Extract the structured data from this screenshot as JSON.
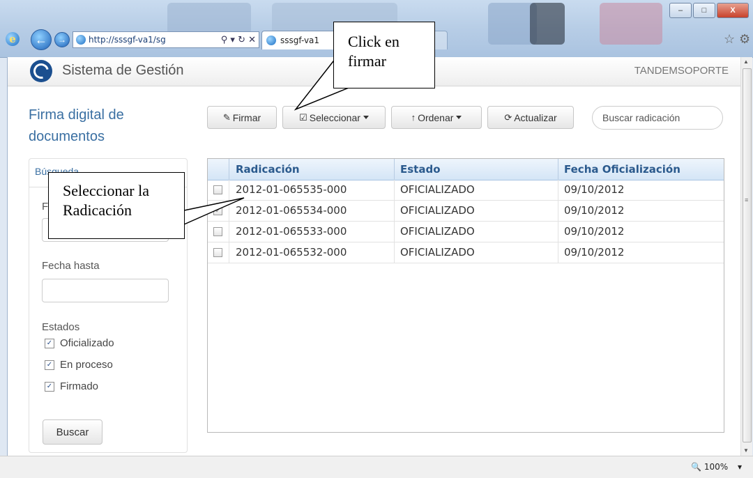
{
  "browser": {
    "url": "http://sssgf-va1/sg",
    "url_controls": "⚲ ▾ ↻ ✕",
    "tab_title": "sssgf-va1",
    "zoom": "100%",
    "zoom_caret": "▾",
    "window_buttons": [
      "–",
      "□",
      "X"
    ],
    "star_icon": "☆",
    "gear_icon": "⚙",
    "back_icon": "←",
    "forward_icon": "→"
  },
  "navbar": {
    "brand": "Sistema de Gestión",
    "user": "TANDEMSOPORTE"
  },
  "page": {
    "title": "Firma digital de documentos"
  },
  "toolbar": {
    "firmar": "Firmar",
    "seleccionar": "Seleccionar",
    "ordenar": "Ordenar",
    "actualizar": "Actualizar",
    "search_placeholder": "Buscar radicación"
  },
  "sidebar": {
    "tab": "Búsqueda",
    "fecha_desde_label": "F",
    "fecha_hasta_label": "Fecha hasta",
    "estados_label": "Estados",
    "estados": [
      {
        "label": "Oficializado",
        "checked": true
      },
      {
        "label": "En proceso",
        "checked": true
      },
      {
        "label": "Firmado",
        "checked": true
      }
    ],
    "buscar": "Buscar"
  },
  "grid": {
    "columns": [
      "Radicación",
      "Estado",
      "Fecha Oficialización"
    ],
    "rows": [
      {
        "radicacion": "2012-01-065535-000",
        "estado": "OFICIALIZADO",
        "fecha": "09/10/2012",
        "checked": false
      },
      {
        "radicacion": "2012-01-065534-000",
        "estado": "OFICIALIZADO",
        "fecha": "09/10/2012",
        "checked": true
      },
      {
        "radicacion": "2012-01-065533-000",
        "estado": "OFICIALIZADO",
        "fecha": "09/10/2012",
        "checked": false
      },
      {
        "radicacion": "2012-01-065532-000",
        "estado": "OFICIALIZADO",
        "fecha": "09/10/2012",
        "checked": false
      }
    ]
  },
  "callouts": {
    "firmar": "Click en firmar",
    "seleccionar": "Seleccionar la Radicación"
  }
}
